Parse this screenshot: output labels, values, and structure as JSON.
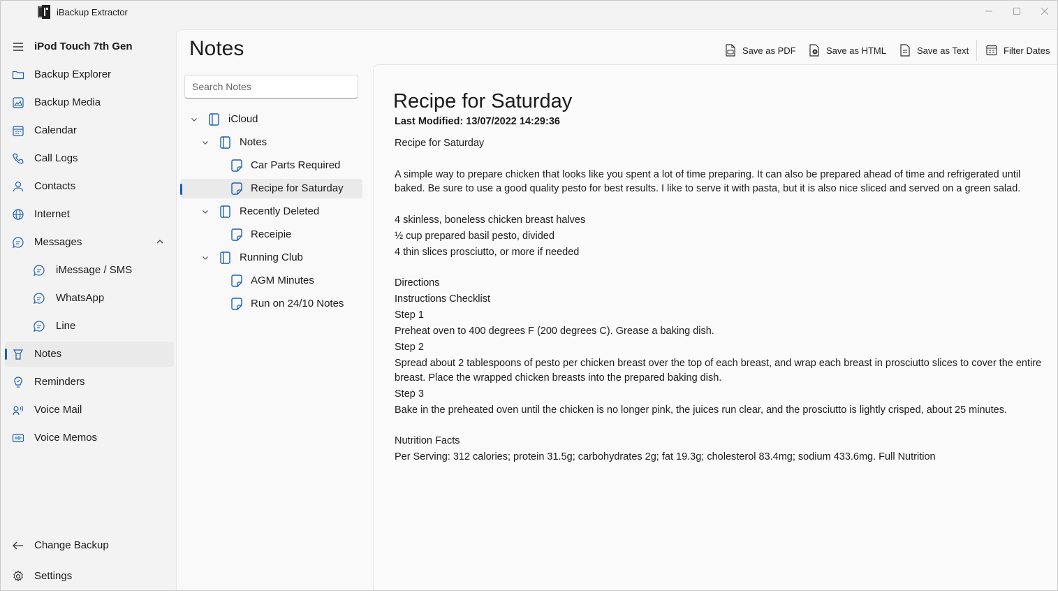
{
  "window": {
    "title": "iBackup Extractor"
  },
  "sidebar": {
    "device_title": "iPod Touch 7th Gen",
    "items": [
      {
        "label": "Backup Explorer",
        "icon": "folder-icon"
      },
      {
        "label": "Backup Media",
        "icon": "image-icon"
      },
      {
        "label": "Calendar",
        "icon": "calendar-icon"
      },
      {
        "label": "Call Logs",
        "icon": "phone-icon"
      },
      {
        "label": "Contacts",
        "icon": "person-icon"
      },
      {
        "label": "Internet",
        "icon": "globe-icon"
      },
      {
        "label": "Messages",
        "icon": "chat-icon",
        "expanded": true
      },
      {
        "label": "iMessage / SMS",
        "icon": "chat-icon"
      },
      {
        "label": "WhatsApp",
        "icon": "chat-icon"
      },
      {
        "label": "Line",
        "icon": "chat-icon"
      },
      {
        "label": "Notes",
        "icon": "notes-icon",
        "selected": true
      },
      {
        "label": "Reminders",
        "icon": "reminder-icon"
      },
      {
        "label": "Voice Mail",
        "icon": "voicemail-icon"
      },
      {
        "label": "Voice Memos",
        "icon": "voicememo-icon"
      }
    ],
    "footer": [
      {
        "label": "Change Backup",
        "icon": "arrow-left-icon"
      },
      {
        "label": "Settings",
        "icon": "gear-icon"
      }
    ]
  },
  "page": {
    "title": "Notes"
  },
  "toolbar": {
    "save_pdf": "Save as PDF",
    "save_html": "Save as HTML",
    "save_text": "Save as Text",
    "filter_dates": "Filter Dates"
  },
  "search": {
    "placeholder": "Search Notes",
    "value": ""
  },
  "tree": [
    {
      "label": "iCloud",
      "type": "account",
      "expanded": true
    },
    {
      "label": "Notes",
      "type": "folder",
      "expanded": true
    },
    {
      "label": "Car Parts Required",
      "type": "note"
    },
    {
      "label": "Recipe for Saturday",
      "type": "note",
      "selected": true
    },
    {
      "label": "Recently Deleted",
      "type": "folder",
      "expanded": true
    },
    {
      "label": "Receipie",
      "type": "note"
    },
    {
      "label": "Running Club",
      "type": "folder",
      "expanded": true
    },
    {
      "label": "AGM Minutes",
      "type": "note"
    },
    {
      "label": "Run on 24/10 Notes",
      "type": "note"
    }
  ],
  "note": {
    "title": "Recipe for Saturday",
    "last_modified": "Last Modified: 13/07/2022 14:29:36",
    "lines": [
      "Recipe for Saturday",
      "",
      "A simple way to prepare chicken that looks like you spent a lot of time preparing. It can also be prepared ahead of time and refrigerated until baked. Be sure to use a good quality pesto for best results. I like to serve it with pasta, but it is also nice sliced and served on a green salad.",
      "",
      "4 skinless, boneless chicken breast halves",
      "½ cup prepared basil pesto, divided",
      "4 thin slices prosciutto, or more if needed",
      "",
      "Directions",
      "Instructions Checklist",
      "Step 1",
      "Preheat oven to 400 degrees F (200 degrees C). Grease a baking dish.",
      "Step 2",
      "Spread about 2 tablespoons of pesto per chicken breast over the top of each breast, and wrap each breast in prosciutto slices to cover the entire breast. Place the wrapped chicken breasts into the prepared baking dish.",
      "Step 3",
      "Bake in the preheated oven until the chicken is no longer pink, the juices run clear, and the prosciutto is lightly crisped, about 25 minutes.",
      "",
      "Nutrition Facts",
      "Per Serving: 312 calories; protein 31.5g; carbohydrates 2g; fat 19.3g; cholesterol 83.4mg; sodium 433.6mg. Full Nutrition"
    ]
  },
  "colors": {
    "accent": "#1a5fb4",
    "window_bg": "#f3f3f3"
  }
}
